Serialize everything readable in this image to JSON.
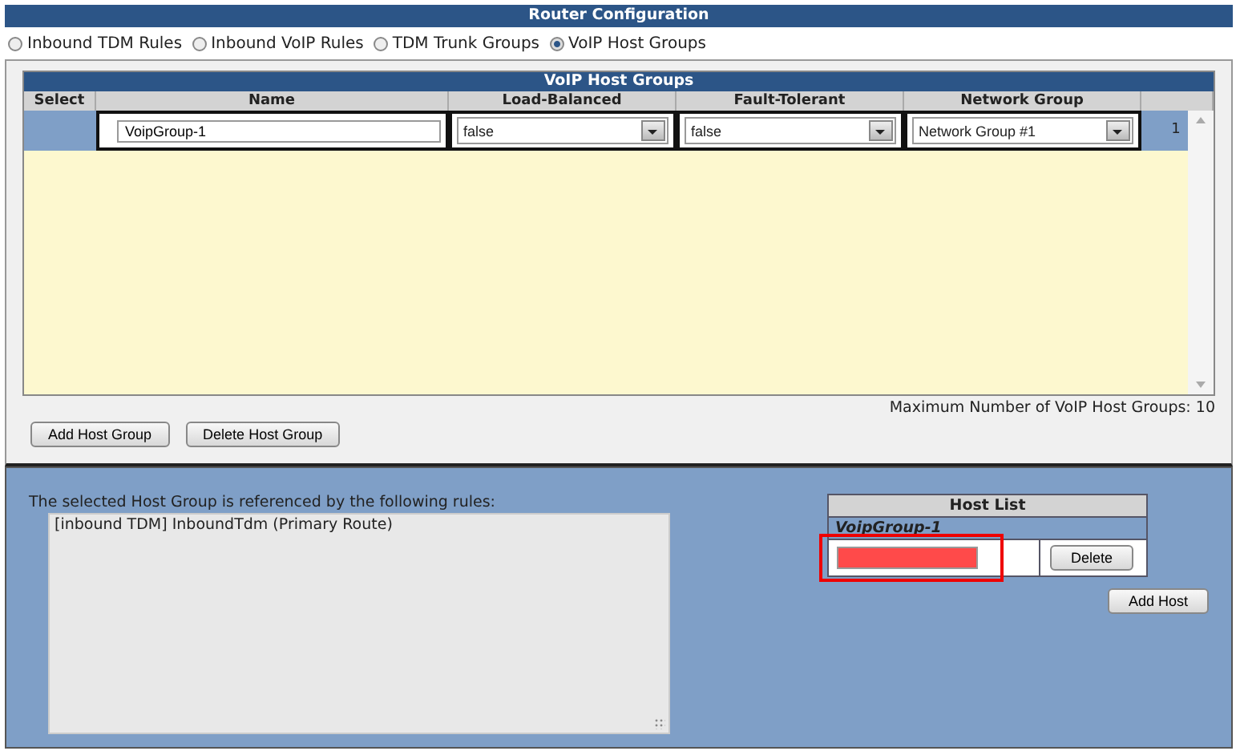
{
  "window": {
    "title": "Router Configuration"
  },
  "tabs": [
    {
      "label": "Inbound TDM Rules",
      "selected": false
    },
    {
      "label": "Inbound VoIP Rules",
      "selected": false
    },
    {
      "label": "TDM Trunk Groups",
      "selected": false
    },
    {
      "label": "VoIP Host Groups",
      "selected": true
    }
  ],
  "groups_table": {
    "title": "VoIP Host Groups",
    "columns": [
      "Select",
      "Name",
      "Load-Balanced",
      "Fault-Tolerant",
      "Network Group"
    ],
    "rows": [
      {
        "selected": true,
        "name": "VoipGroup-1",
        "load_balanced": "false",
        "fault_tolerant": "false",
        "network_group": "Network Group #1",
        "index": "1"
      }
    ]
  },
  "max_note": "Maximum Number of VoIP Host Groups: 10",
  "buttons": [
    "Add Host Group",
    "Delete Host Group"
  ],
  "rules_panel": {
    "label": "The selected Host Group is referenced by the following rules:",
    "rules": [
      "[inbound TDM] InboundTdm (Primary Route)"
    ]
  },
  "host_list": {
    "title": "Host List",
    "group": "VoipGroup-1",
    "hosts": [
      {
        "error": true,
        "highlighted": true,
        "button": "Delete"
      }
    ],
    "add_button": "Add Host"
  }
}
